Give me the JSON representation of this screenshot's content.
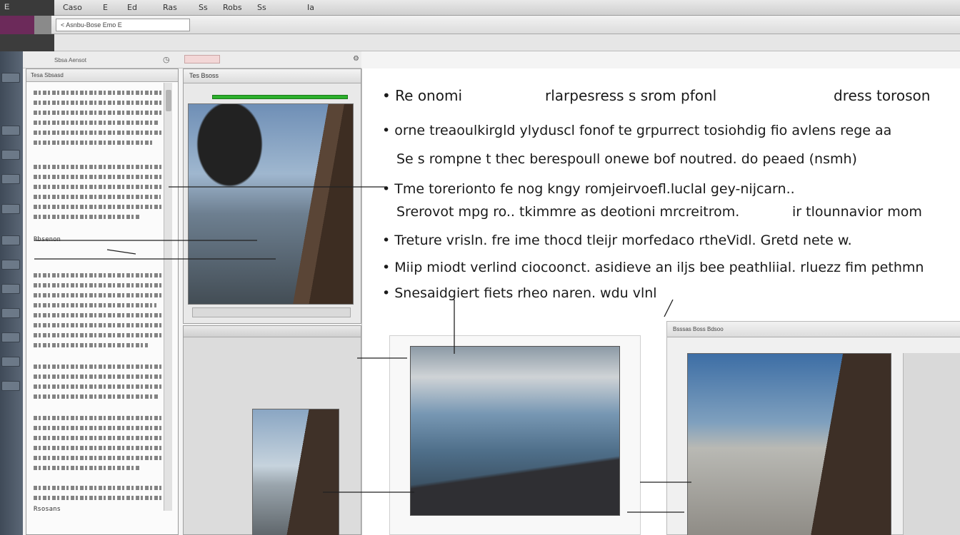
{
  "menubar": {
    "logo": "E",
    "items": [
      "Caso",
      "E",
      "Ed",
      "Ras",
      "Ss",
      "Robs",
      "Ss",
      "Ia"
    ]
  },
  "toolbar": {
    "path_text": "< Asnbu-Bose Emo E"
  },
  "options": {
    "text": "Sbsa Aensot"
  },
  "left_panel": {
    "header": "Tesa Sbsasd",
    "labels": [
      "Rbsenon",
      "Rsosans"
    ]
  },
  "mid_panel": {
    "header": "Tes Bsoss"
  },
  "document": {
    "bullets": [
      "Re onomi",
      "orne treaoulkirgld ylyduscl fonof te grpurrect tosiohdig fio avlens rege aa",
      "Tme torerionto fe nog kngy romjeirvoefl.luclal gey-nijcarn..",
      "Treture vrisln. fre ime thocd tleijr morfedaco rtheVidl. Gretd nete w.",
      "Miip miodt verlind ciocoonct. asidieve an iljs bee peathliial. rluezz fim pethmn",
      "Snesaidgiert fiets rheo naren. wdu vlnl"
    ],
    "heading_mid": "rlarpesress s srom pfonl",
    "heading_right": "dress toroson",
    "line2": "Se s rompne t thec berespoull onewe bof noutred. do peaed (nsmh)",
    "line3b": "Srerovot mpg ro.. tkimmre as deotioni mrcreitrom.",
    "line3c": "ir tlounnavior mom"
  },
  "figure_panel": {
    "header": "Bsssas Boss Bdsoo"
  }
}
